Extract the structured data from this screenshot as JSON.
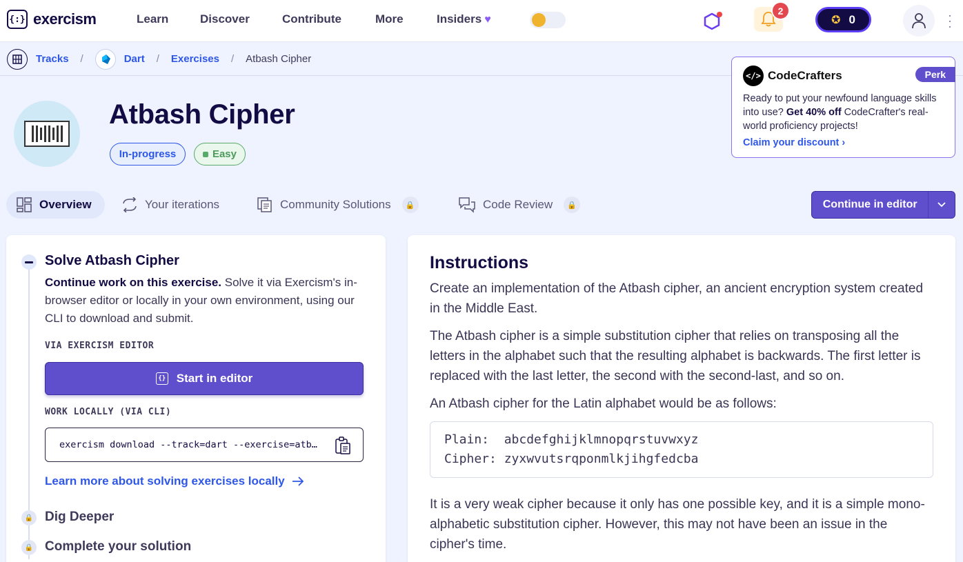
{
  "header": {
    "brand": "exercism",
    "logo_glyph": "{:}",
    "nav": [
      "Learn",
      "Discover",
      "Contribute",
      "More",
      "Insiders"
    ],
    "notification_count": "2",
    "reputation": "0"
  },
  "breadcrumb": {
    "tracks": "Tracks",
    "track": "Dart",
    "exercises": "Exercises",
    "current": "Atbash Cipher",
    "separator": "/"
  },
  "perk": {
    "logo_glyph": "</>",
    "name": "CodeCrafters",
    "badge": "Perk",
    "text_before": "Ready to put your newfound language skills into use? ",
    "text_bold": "Get 40% off",
    "text_after": " CodeCrafter's real-world proficiency projects!",
    "link": "Claim your discount"
  },
  "exercise": {
    "title": "Atbash Cipher",
    "status": "In-progress",
    "difficulty": "Easy"
  },
  "tabs": {
    "overview": "Overview",
    "iterations": "Your iterations",
    "community": "Community Solutions",
    "review": "Code Review",
    "lock_glyph": "🔒"
  },
  "editor_button": "Continue in editor",
  "steps": {
    "solve_title": "Solve Atbash Cipher",
    "solve_lead": "Continue work on this exercise.",
    "solve_desc": " Solve it via Exercism's in-browser editor or locally in your own environment, using our CLI to download and submit.",
    "via_editor_label": "VIA EXERCISM EDITOR",
    "start_button": "Start in editor",
    "code_icon_glyph": "{}",
    "work_locally_label": "WORK LOCALLY (VIA CLI)",
    "cli_command": "exercism download --track=dart --exercise=atbash-cipher",
    "learn_more": "Learn more about solving exercises locally",
    "dig_deeper": "Dig Deeper",
    "complete": "Complete your solution"
  },
  "instructions": {
    "title": "Instructions",
    "p1": "Create an implementation of the Atbash cipher, an ancient encryption system created in the Middle East.",
    "p2": "The Atbash cipher is a simple substitution cipher that relies on transposing all the letters in the alphabet such that the resulting alphabet is backwards. The first letter is replaced with the last letter, the second with the second-last, and so on.",
    "p3": "An Atbash cipher for the Latin alphabet would be as follows:",
    "cipher_table": "Plain:  abcdefghijklmnopqrstuvwxyz\nCipher: zyxwvutsrqponmlkjihgfedcba",
    "p4": "It is a very weak cipher because it only has one possible key, and it is a simple mono-alphabetic substitution cipher. However, this may not have been an issue in the cipher's time."
  },
  "colors": {
    "accent": "#604fcd",
    "link": "#2e57e8",
    "background": "#eef3ff"
  }
}
